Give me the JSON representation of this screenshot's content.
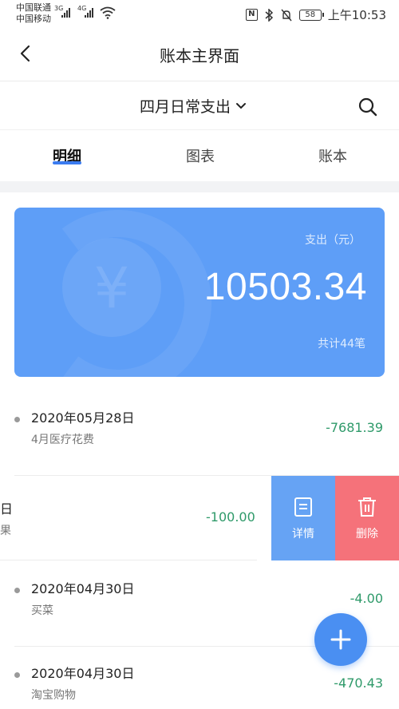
{
  "status_bar": {
    "carrier_1": "中国联通",
    "carrier_2": "中国移动",
    "signal_1": "3G",
    "signal_2": "4G",
    "battery": "58",
    "time": "上午10:53"
  },
  "header": {
    "title": "账本主界面"
  },
  "book_selector": {
    "name": "四月日常支出"
  },
  "tabs": [
    {
      "label": "明细",
      "active": true
    },
    {
      "label": "图表",
      "active": false
    },
    {
      "label": "账本",
      "active": false
    }
  ],
  "summary": {
    "label": "支出（元）",
    "amount": "10503.34",
    "count": "共计44笔"
  },
  "records": [
    {
      "date": "2020年05月28日",
      "note": "4月医疗花费",
      "amount": "-7681.39"
    },
    {
      "date": "日",
      "note": "果",
      "amount": "-100.00"
    },
    {
      "date": "2020年04月30日",
      "note": "买菜",
      "amount": "-4.00"
    },
    {
      "date": "2020年04月30日",
      "note": "淘宝购物",
      "amount": "-470.43"
    }
  ],
  "swipe_actions": {
    "details": "详情",
    "delete": "删除"
  },
  "colors": {
    "accent": "#5e9ef7",
    "expense_green": "#2f9a6a",
    "delete_red": "#f5727a"
  }
}
